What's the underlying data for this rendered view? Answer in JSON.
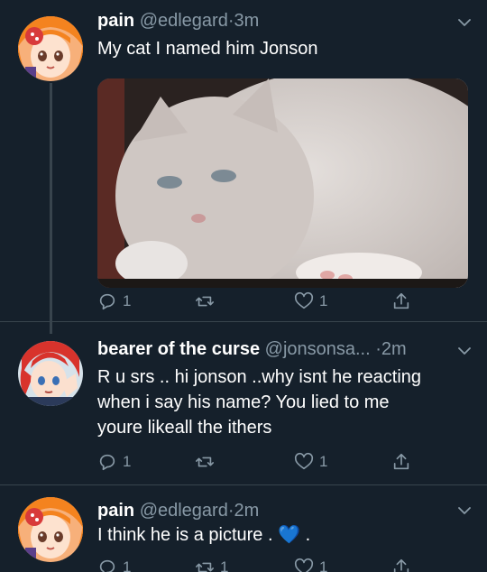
{
  "tweets": [
    {
      "name": "pain",
      "handle": "@edlegard",
      "separator": "·",
      "time": "3m",
      "text": "My cat I named him Jonson",
      "replies": "1",
      "retweets": "",
      "likes": "1"
    },
    {
      "name": "bearer of the curse",
      "handle": "@jonsonsa...",
      "separator": "·",
      "time": "2m",
      "text_lines": [
        "R u srs .. hi jonson ..why isnt he reacting",
        "when i say his name? You lied to me",
        "youre likeall the ithers"
      ],
      "replies": "1",
      "retweets": "",
      "likes": "1"
    },
    {
      "name": "pain",
      "handle": "@edlegard",
      "separator": "·",
      "time": "2m",
      "text_before": "I think he is a picture .",
      "emoji": "💙",
      "text_after": ".",
      "replies": "1",
      "retweets": "1",
      "likes": "1"
    }
  ],
  "colors": {
    "background": "#15202b",
    "muted": "#8899a6",
    "heart_emoji": "#3b8beb"
  }
}
